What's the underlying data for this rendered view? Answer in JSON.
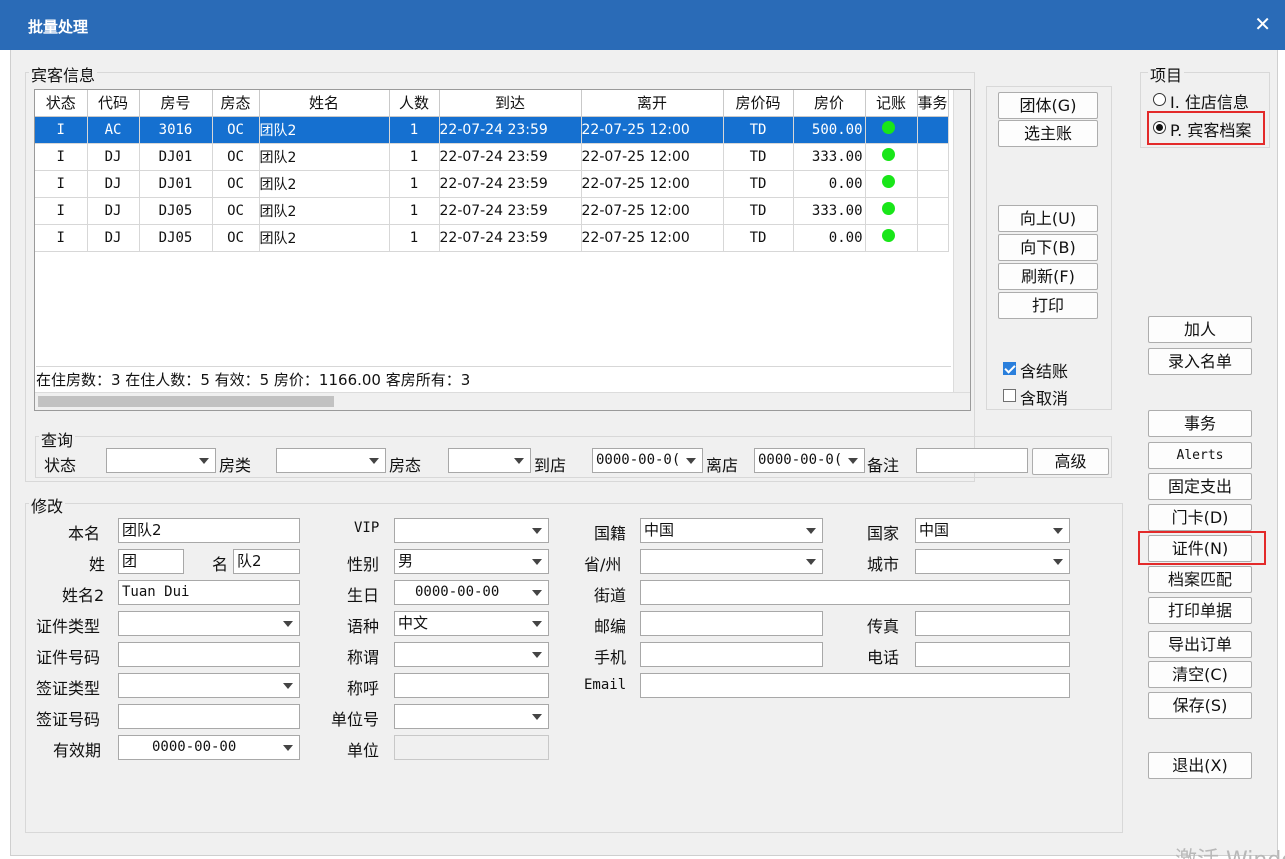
{
  "window": {
    "title": "批量处理",
    "close": "✕"
  },
  "guest_info": {
    "legend": "宾客信息",
    "columns": [
      "状态",
      "代码",
      "房号",
      "房态",
      "姓名",
      "人数",
      "到达",
      "离开",
      "房价码",
      "房价",
      "记账",
      "事务"
    ],
    "rows": [
      {
        "status": "I",
        "code": "AC",
        "room": "3016",
        "room_status": "OC",
        "name": "团队2",
        "count": "1",
        "arrive": "22-07-24 23:59",
        "depart": "22-07-25 12:00",
        "rate_code": "TD",
        "rate": "500.00",
        "posting": true,
        "selected": true
      },
      {
        "status": "I",
        "code": "DJ",
        "room": "DJ01",
        "room_status": "OC",
        "name": "团队2",
        "count": "1",
        "arrive": "22-07-24 23:59",
        "depart": "22-07-25 12:00",
        "rate_code": "TD",
        "rate": "333.00",
        "posting": true,
        "selected": false
      },
      {
        "status": "I",
        "code": "DJ",
        "room": "DJ01",
        "room_status": "OC",
        "name": "团队2",
        "count": "1",
        "arrive": "22-07-24 23:59",
        "depart": "22-07-25 12:00",
        "rate_code": "TD",
        "rate": "0.00",
        "posting": true,
        "selected": false
      },
      {
        "status": "I",
        "code": "DJ",
        "room": "DJ05",
        "room_status": "OC",
        "name": "团队2",
        "count": "1",
        "arrive": "22-07-24 23:59",
        "depart": "22-07-25 12:00",
        "rate_code": "TD",
        "rate": "333.00",
        "posting": true,
        "selected": false
      },
      {
        "status": "I",
        "code": "DJ",
        "room": "DJ05",
        "room_status": "OC",
        "name": "团队2",
        "count": "1",
        "arrive": "22-07-24 23:59",
        "depart": "22-07-25 12:00",
        "rate_code": "TD",
        "rate": "0.00",
        "posting": true,
        "selected": false
      }
    ],
    "summary": "在住房数：3   在住人数：5   有效：5   房价：1166.00   客房所有：3"
  },
  "side_buttons": {
    "group": "团体(G)",
    "select_main": "选主账",
    "up": "向上(U)",
    "down": "向下(B)",
    "refresh": "刷新(F)",
    "print": "打印",
    "include_checkout": "含结账",
    "include_cancel": "含取消"
  },
  "query": {
    "legend": "查询",
    "status_label": "状态",
    "room_type_label": "房类",
    "room_status_label": "房态",
    "arrive_label": "到店",
    "arrive_value": "0000-00-0(",
    "depart_label": "离店",
    "depart_value": "0000-00-0(",
    "remark_label": "备注",
    "advanced": "高级"
  },
  "modify": {
    "legend": "修改",
    "name_label": "本名",
    "name_value": "团队2",
    "surname_label": "姓",
    "surname_value": "团",
    "given_label": "名",
    "given_value": "队2",
    "name2_label": "姓名2",
    "name2_value": "Tuan Dui",
    "id_type_label": "证件类型",
    "id_no_label": "证件号码",
    "visa_type_label": "签证类型",
    "visa_no_label": "签证号码",
    "valid_label": "有效期",
    "valid_value": "0000-00-00",
    "vip_label": "VIP",
    "gender_label": "性别",
    "gender_value": "男",
    "birthday_label": "生日",
    "birthday_value": "0000-00-00",
    "language_label": "语种",
    "language_value": "中文",
    "title_label": "称谓",
    "salutation_label": "称呼",
    "unit_no_label": "单位号",
    "unit_label": "单位",
    "nationality_label": "国籍",
    "nationality_value": "中国",
    "province_label": "省/州",
    "street_label": "街道",
    "zip_label": "邮编",
    "mobile_label": "手机",
    "email_label": "Email",
    "country_label": "国家",
    "country_value": "中国",
    "city_label": "城市",
    "fax_label": "传真",
    "phone_label": "电话"
  },
  "items": {
    "legend": "项目",
    "opt_stay": "I. 住店信息",
    "opt_profile": "P. 宾客档案"
  },
  "right_buttons": {
    "add_person": "加人",
    "enter_list": "录入名单",
    "affairs": "事务",
    "alerts": "Alerts",
    "fixed_charge": "固定支出",
    "door_card": "门卡(D)",
    "documents": "证件(N)",
    "profile_match": "档案匹配",
    "print_receipt": "打印单据",
    "export_order": "导出订单",
    "clear": "清空(C)",
    "save": "保存(S)",
    "exit": "退出(X)"
  },
  "watermark": "激活 Windo",
  "colors": {
    "title_bar": "#2a6bb7",
    "selection": "#1570d0",
    "posting_dot": "#19e619",
    "highlight_box": "#e32a2a"
  }
}
